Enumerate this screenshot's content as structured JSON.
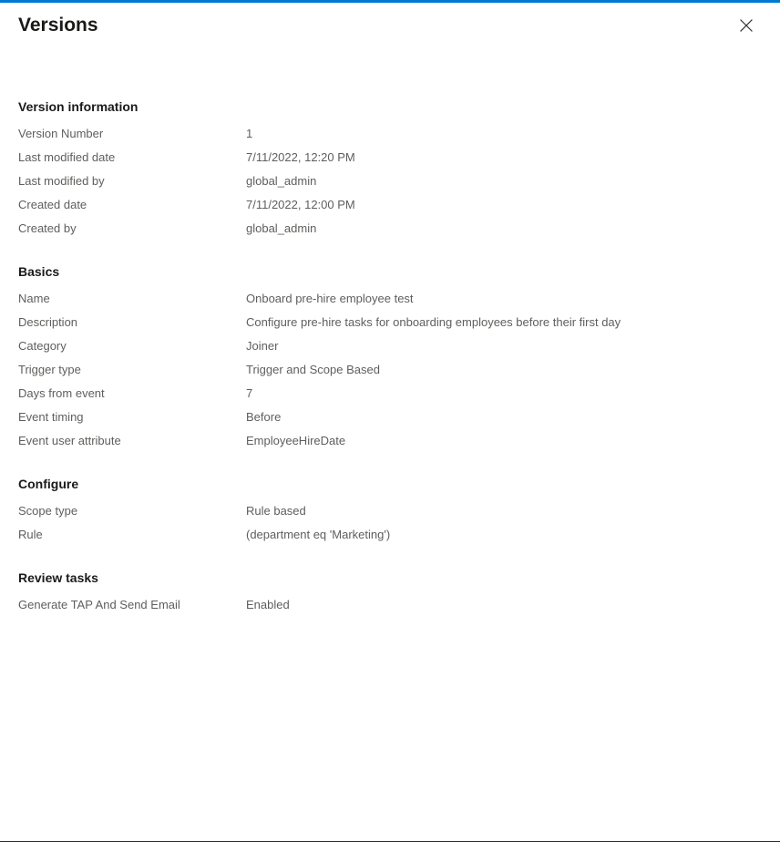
{
  "panel": {
    "title": "Versions",
    "close_icon": "close-icon",
    "close_label": "Close"
  },
  "sections": [
    {
      "heading": "Version information",
      "rows": [
        {
          "label": "Version Number",
          "value": "1"
        },
        {
          "label": "Last modified date",
          "value": "7/11/2022, 12:20 PM"
        },
        {
          "label": "Last modified by",
          "value": "global_admin"
        },
        {
          "label": "Created date",
          "value": "7/11/2022, 12:00 PM"
        },
        {
          "label": "Created by",
          "value": "global_admin"
        }
      ]
    },
    {
      "heading": "Basics",
      "rows": [
        {
          "label": "Name",
          "value": "Onboard pre-hire employee test"
        },
        {
          "label": "Description",
          "value": "Configure pre-hire tasks for onboarding employees before their first day"
        },
        {
          "label": "Category",
          "value": "Joiner"
        },
        {
          "label": "Trigger type",
          "value": "Trigger and Scope Based"
        },
        {
          "label": "Days from event",
          "value": "7"
        },
        {
          "label": "Event timing",
          "value": "Before"
        },
        {
          "label": "Event user attribute",
          "value": "EmployeeHireDate"
        }
      ]
    },
    {
      "heading": "Configure",
      "rows": [
        {
          "label": "Scope type",
          "value": "Rule based"
        },
        {
          "label": "Rule",
          "value": "(department eq 'Marketing')"
        }
      ]
    },
    {
      "heading": "Review tasks",
      "rows": [
        {
          "label": "Generate TAP And Send Email",
          "value": "Enabled"
        }
      ]
    }
  ],
  "colors": {
    "accent": "#0078d4",
    "heading_text": "#1b1a19",
    "body_text": "#605e5c"
  }
}
